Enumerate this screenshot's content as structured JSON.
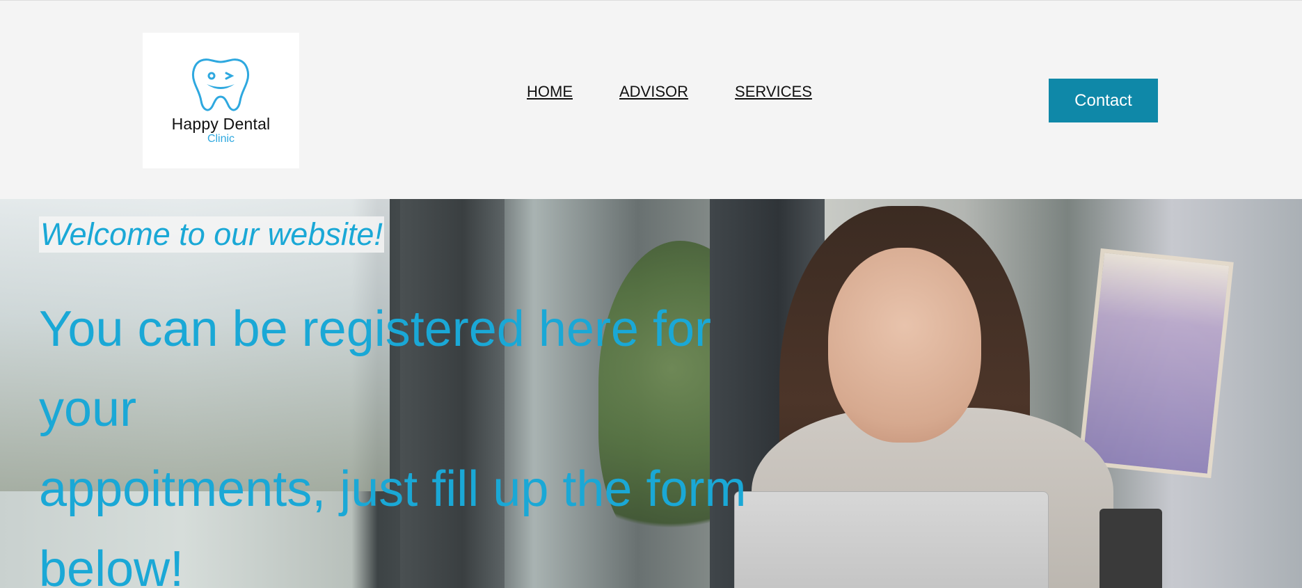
{
  "brand": {
    "name": "Happy Dental",
    "subtitle": "Clinic",
    "primary_color": "#1aa8d6",
    "logo_icon": "smiling-tooth-icon"
  },
  "nav": {
    "items": [
      {
        "label": "HOME"
      },
      {
        "label": "ADVISOR"
      },
      {
        "label": "SERVICES"
      }
    ]
  },
  "header": {
    "contact_label": "Contact",
    "contact_color": "#0f88a8"
  },
  "hero": {
    "welcome": "Welcome to our website!",
    "headline_lines": [
      "You can be registered here for",
      "your",
      "appoitments, just fill up the form",
      "below!"
    ],
    "background": "photo of woman working on laptop in cafe"
  }
}
